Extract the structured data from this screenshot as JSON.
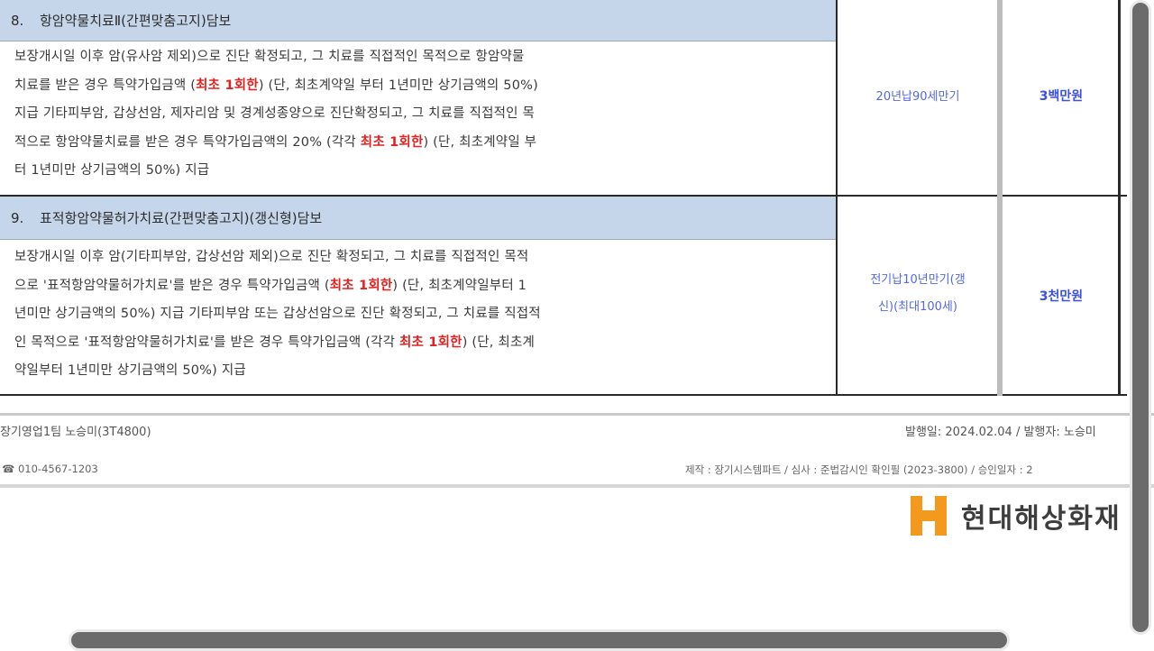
{
  "sections": [
    {
      "num": "8.",
      "title": "항암약물치료Ⅱ(간편맞춤고지)담보",
      "lines": [
        [
          {
            "t": "보장개시일 이후 암(유사암 제외)으로 진단 확정되고, 그 치료를 직접적인 목적으로 항암약물"
          }
        ],
        [
          {
            "t": "치료를 받은 경우 특약가입금액 ("
          },
          {
            "t": "최초 1회한",
            "red": true
          },
          {
            "t": ") (단, 최초계약일 부터 1년미만 상기금액의 50%)"
          }
        ],
        [
          {
            "t": "지급 기타피부암, 갑상선암, 제자리암 및 경계성종양으로 진단확정되고, 그 치료를 직접적인 목"
          }
        ],
        [
          {
            "t": "적으로 항암약물치료를 받은 경우 특약가입금액의 20% (각각 "
          },
          {
            "t": "최초 1회한",
            "red": true
          },
          {
            "t": ") (단, 최초계약일 부"
          }
        ],
        [
          {
            "t": "터 1년미만 상기금액의 50%) 지급"
          }
        ]
      ],
      "period": "20년납90세만기",
      "amount": "3백만원"
    },
    {
      "num": "9.",
      "title": "표적항암약물허가치료(간편맞춤고지)(갱신형)담보",
      "lines": [
        [
          {
            "t": "보장개시일 이후 암(기타피부암, 갑상선암 제외)으로 진단 확정되고, 그 치료를 직접적인 목적"
          }
        ],
        [
          {
            "t": "으로 '표적항암약물허가치료'를 받은 경우 특약가입금액 ("
          },
          {
            "t": "최초 1회한",
            "red": true
          },
          {
            "t": ") (단, 최초계약일부터 1"
          }
        ],
        [
          {
            "t": "년미만 상기금액의 50%) 지급 기타피부암 또는 갑상선암으로 진단 확정되고, 그 치료를 직접적"
          }
        ],
        [
          {
            "t": "인 목적으로 '표적항암약물허가치료'를 받은 경우 특약가입금액 (각각 "
          },
          {
            "t": "최초 1회한",
            "red": true
          },
          {
            "t": ") (단, 최초계"
          }
        ],
        [
          {
            "t": "약일부터 1년미만 상기금액의 50%) 지급"
          }
        ]
      ],
      "period_lines": [
        "전기납10년만기(갱",
        "신)(최대100세)"
      ],
      "amount": "3천만원"
    }
  ],
  "footer": {
    "product": "장기영업1팀 노승미(3T4800)",
    "issue": "발행일: 2024.02.04 / 발행자: 노승미",
    "contact": "☎ 010-4567-1203",
    "review": "제작 : 장기시스템파트 / 심사 : 준법감시인 확인필 (2023-3800) / 승인일자 : 2"
  },
  "logo_text": "현대해상화재",
  "colors": {
    "header_bg": "#c5d5ea",
    "emphasis_red": "#e5201f",
    "value_blue": "#3b4fe0",
    "logo_orange": "#f39a1e"
  }
}
